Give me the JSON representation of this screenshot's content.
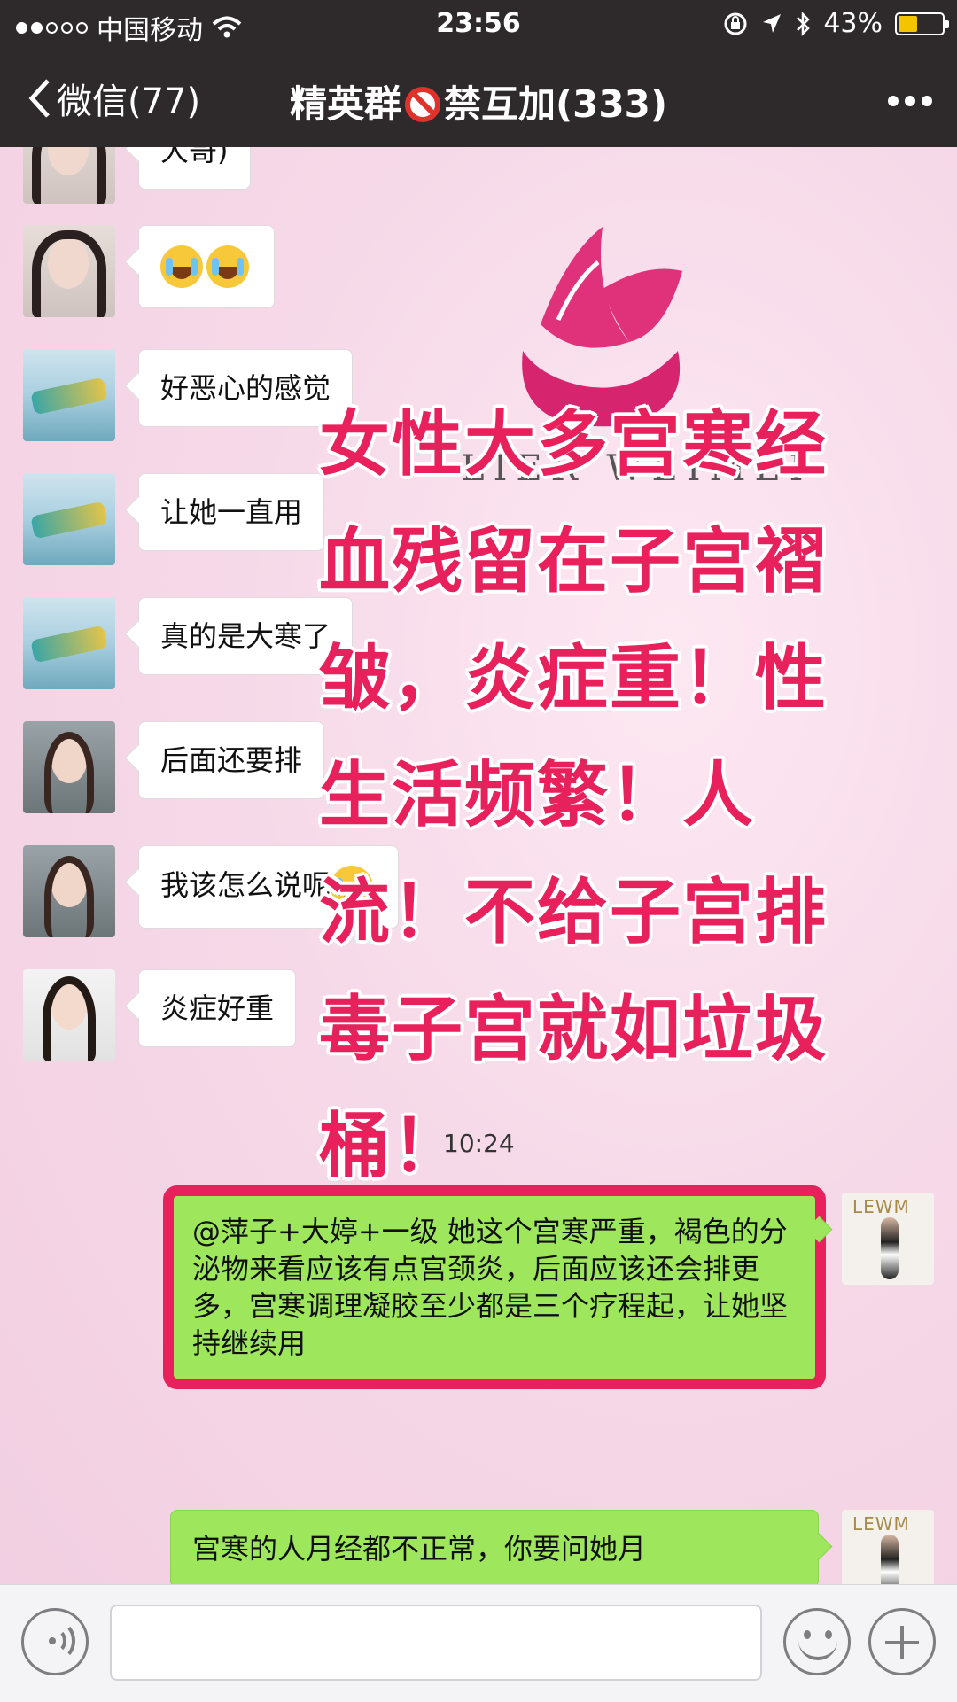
{
  "status_bar": {
    "carrier": "中国移动",
    "time": "23:56",
    "battery": "43%",
    "battery_level": 0.43
  },
  "nav": {
    "back_label": "微信(77)",
    "title_part1": "精英群",
    "title_part2": "禁互加(333)"
  },
  "background_brand": "LIER WEIMEI",
  "messages": [
    {
      "text": "大哥)"
    },
    {
      "emoji_count": 2
    },
    {
      "text": "好恶心的感觉"
    },
    {
      "text": "让她一直用"
    },
    {
      "text": "真的是大寒了"
    },
    {
      "text": "后面还要排"
    },
    {
      "text": "我该怎么说呢"
    },
    {
      "text": "炎症好重"
    }
  ],
  "timestamp": "10:24",
  "overlay_lines": [
    "女性大多宫寒经",
    "血残留在子宫褶",
    "皱，炎症重！性",
    "生活频繁！人",
    "流！不给子宫排",
    "毒子宫就如垃圾",
    "桶！"
  ],
  "right_messages": [
    {
      "text": "@萍子+大婷+一级 她这个宫寒严重，褐色的分泌物来看应该有点宫颈炎，后面应该还会排更多，宫寒调理凝胶至少都是三个疗程起，让她坚持继续用",
      "avatar_label": "LEWM"
    },
    {
      "text": "宫寒的人月经都不正常，你要问她月",
      "avatar_label": "LEWM"
    }
  ],
  "colors": {
    "overlay_text": "#e8215d",
    "sent_bubble": "#9ee75c",
    "nav_bg": "#2e2a2c"
  },
  "icons": [
    "back-chevron-icon",
    "no-entry-icon",
    "more-icon",
    "voice-icon",
    "emoji-icon",
    "plus-icon"
  ]
}
